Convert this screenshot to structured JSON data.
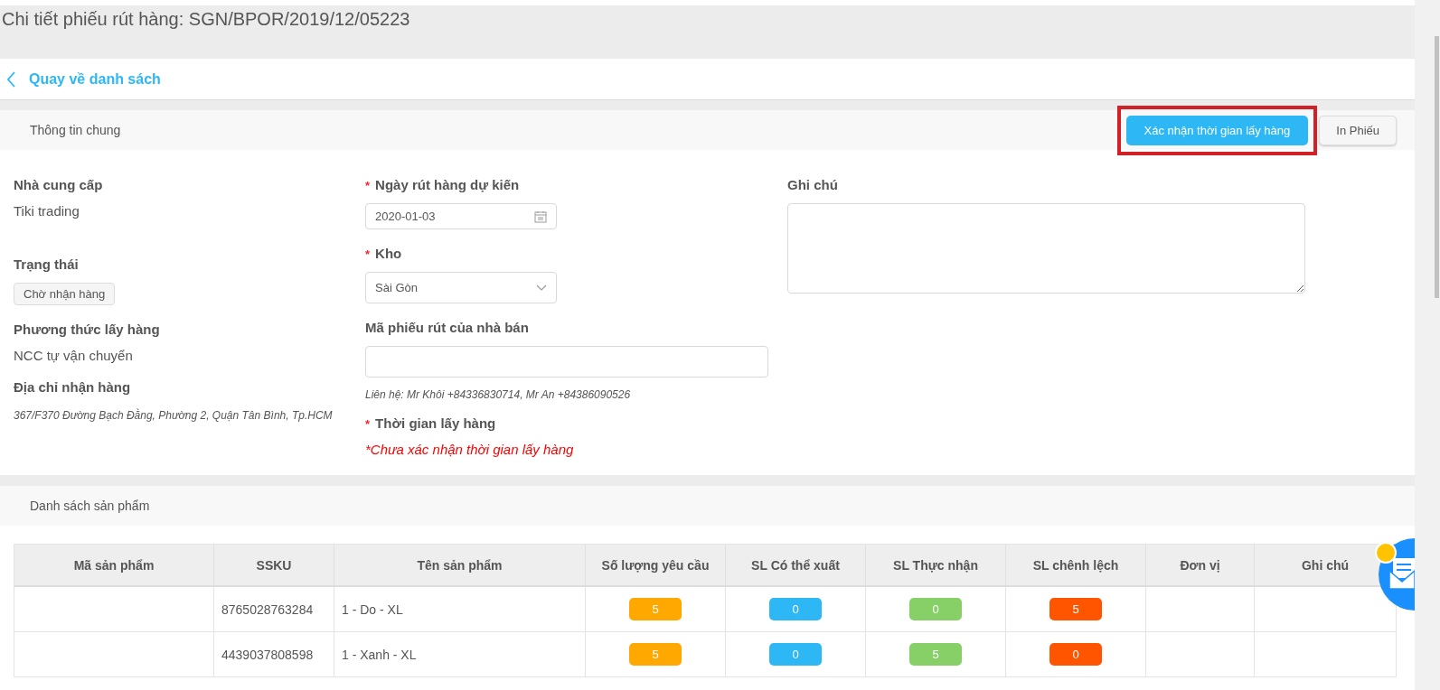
{
  "page_title": "Chi tiết phiếu rút hàng: SGN/BPOR/2019/12/05223",
  "back_link": "Quay về danh sách",
  "general": {
    "title": "Thông tin chung",
    "actions": [
      {
        "label": "Xác nhận thời gian lấy hàng",
        "kind": "primary",
        "highlighted": true
      },
      {
        "label": "In Phiếu",
        "kind": "default",
        "highlighted": false
      }
    ],
    "supplier": {
      "label": "Nhà cung cấp",
      "value": "Tiki trading"
    },
    "status": {
      "label": "Trạng thái",
      "value": "Chờ nhận hàng"
    },
    "method": {
      "label": "Phương thức lấy hàng",
      "value": "NCC tự vận chuyển"
    },
    "address": {
      "label": "Địa chỉ nhận hàng",
      "value": "367/F370 Đường Bạch Đằng, Phường 2, Quận Tân Bình, Tp.HCM"
    },
    "date": {
      "label": "Ngày rút hàng dự kiến",
      "required_mark": "*",
      "value": "2020-01-03"
    },
    "warehouse": {
      "label": "Kho",
      "required_mark": "*",
      "value": "Sài Gòn"
    },
    "seller_code": {
      "label": "Mã phiếu rút của nhà bán"
    },
    "contact": "Liên hệ: Mr Khôi +84336830714, Mr An +84386090526",
    "pickup_time": {
      "label": "Thời gian lấy hàng",
      "required_mark": "*",
      "value": "*Chưa xác nhận thời gian lấy hàng"
    },
    "note": {
      "label": "Ghi chú"
    }
  },
  "products": {
    "title": "Danh sách sản phẩm",
    "columns": [
      "Mã sản phẩm",
      "SSKU",
      "Tên sản phẩm",
      "Số lượng yêu cầu",
      "SL Có thể xuất",
      "SL Thực nhận",
      "SL chênh lệch",
      "Đơn vị",
      "Ghi chú"
    ],
    "rows": [
      {
        "ssku": "8765028763284",
        "name": "1 - Do - XL",
        "quantities": [
          {
            "value": "5",
            "color": "#ffa800"
          },
          {
            "value": "0",
            "color": "#2db7f5"
          },
          {
            "value": "0",
            "color": "#87d068"
          },
          {
            "value": "5",
            "color": "#ff5500"
          }
        ]
      },
      {
        "ssku": "4439037808598",
        "name": "1 - Xanh - XL",
        "quantities": [
          {
            "value": "5",
            "color": "#ffa800"
          },
          {
            "value": "0",
            "color": "#2db7f5"
          },
          {
            "value": "5",
            "color": "#87d068"
          },
          {
            "value": "0",
            "color": "#ff5500"
          }
        ]
      }
    ]
  }
}
